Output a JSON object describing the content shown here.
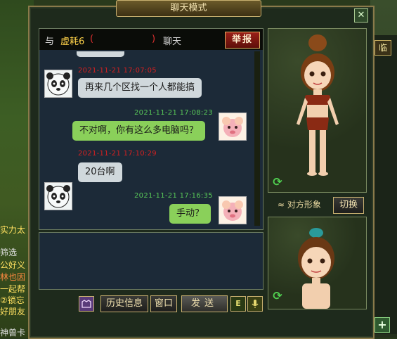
{
  "window": {
    "title": "聊天模式",
    "close": "✕"
  },
  "header": {
    "prefix": "与",
    "name": "虚耗6",
    "paren_open": "(",
    "paren_close": ")",
    "suffix": "聊天",
    "report_label": "举报"
  },
  "messages": [
    {
      "time": "2021-11-21 17:07:05",
      "text": "再来几个区找一个人都能搞",
      "side": "left"
    },
    {
      "time": "2021-11-21 17:08:23",
      "text": "不对啊，你有这么多电脑吗？",
      "side": "right"
    },
    {
      "time": "2021-11-21 17:10:29",
      "text": "20台啊",
      "side": "left"
    },
    {
      "time": "2021-11-21 17:16:35",
      "text": "手动？",
      "side": "right"
    }
  ],
  "toolbar": {
    "history_label": "历史信息",
    "window_label": "窗口",
    "send_label": "发送",
    "emote_label": "E"
  },
  "portrait": {
    "role_label": "对方形象",
    "switch_label": "切换"
  },
  "background": {
    "left_lines": [
      "实力太",
      "筛选",
      "公好义",
      "林也因",
      "一起帮",
      "②锁忘",
      "好朋友",
      "神兽卡"
    ],
    "right_tab": "临",
    "right_btn_plus": "+"
  },
  "colors": {
    "accent_gold": "#c8b070",
    "red_time": "#d82020",
    "green_time": "#58c858",
    "name_yellow": "#ffd24a",
    "bubble_green": "#8ad05a",
    "bubble_gray": "#d0d8dc"
  }
}
